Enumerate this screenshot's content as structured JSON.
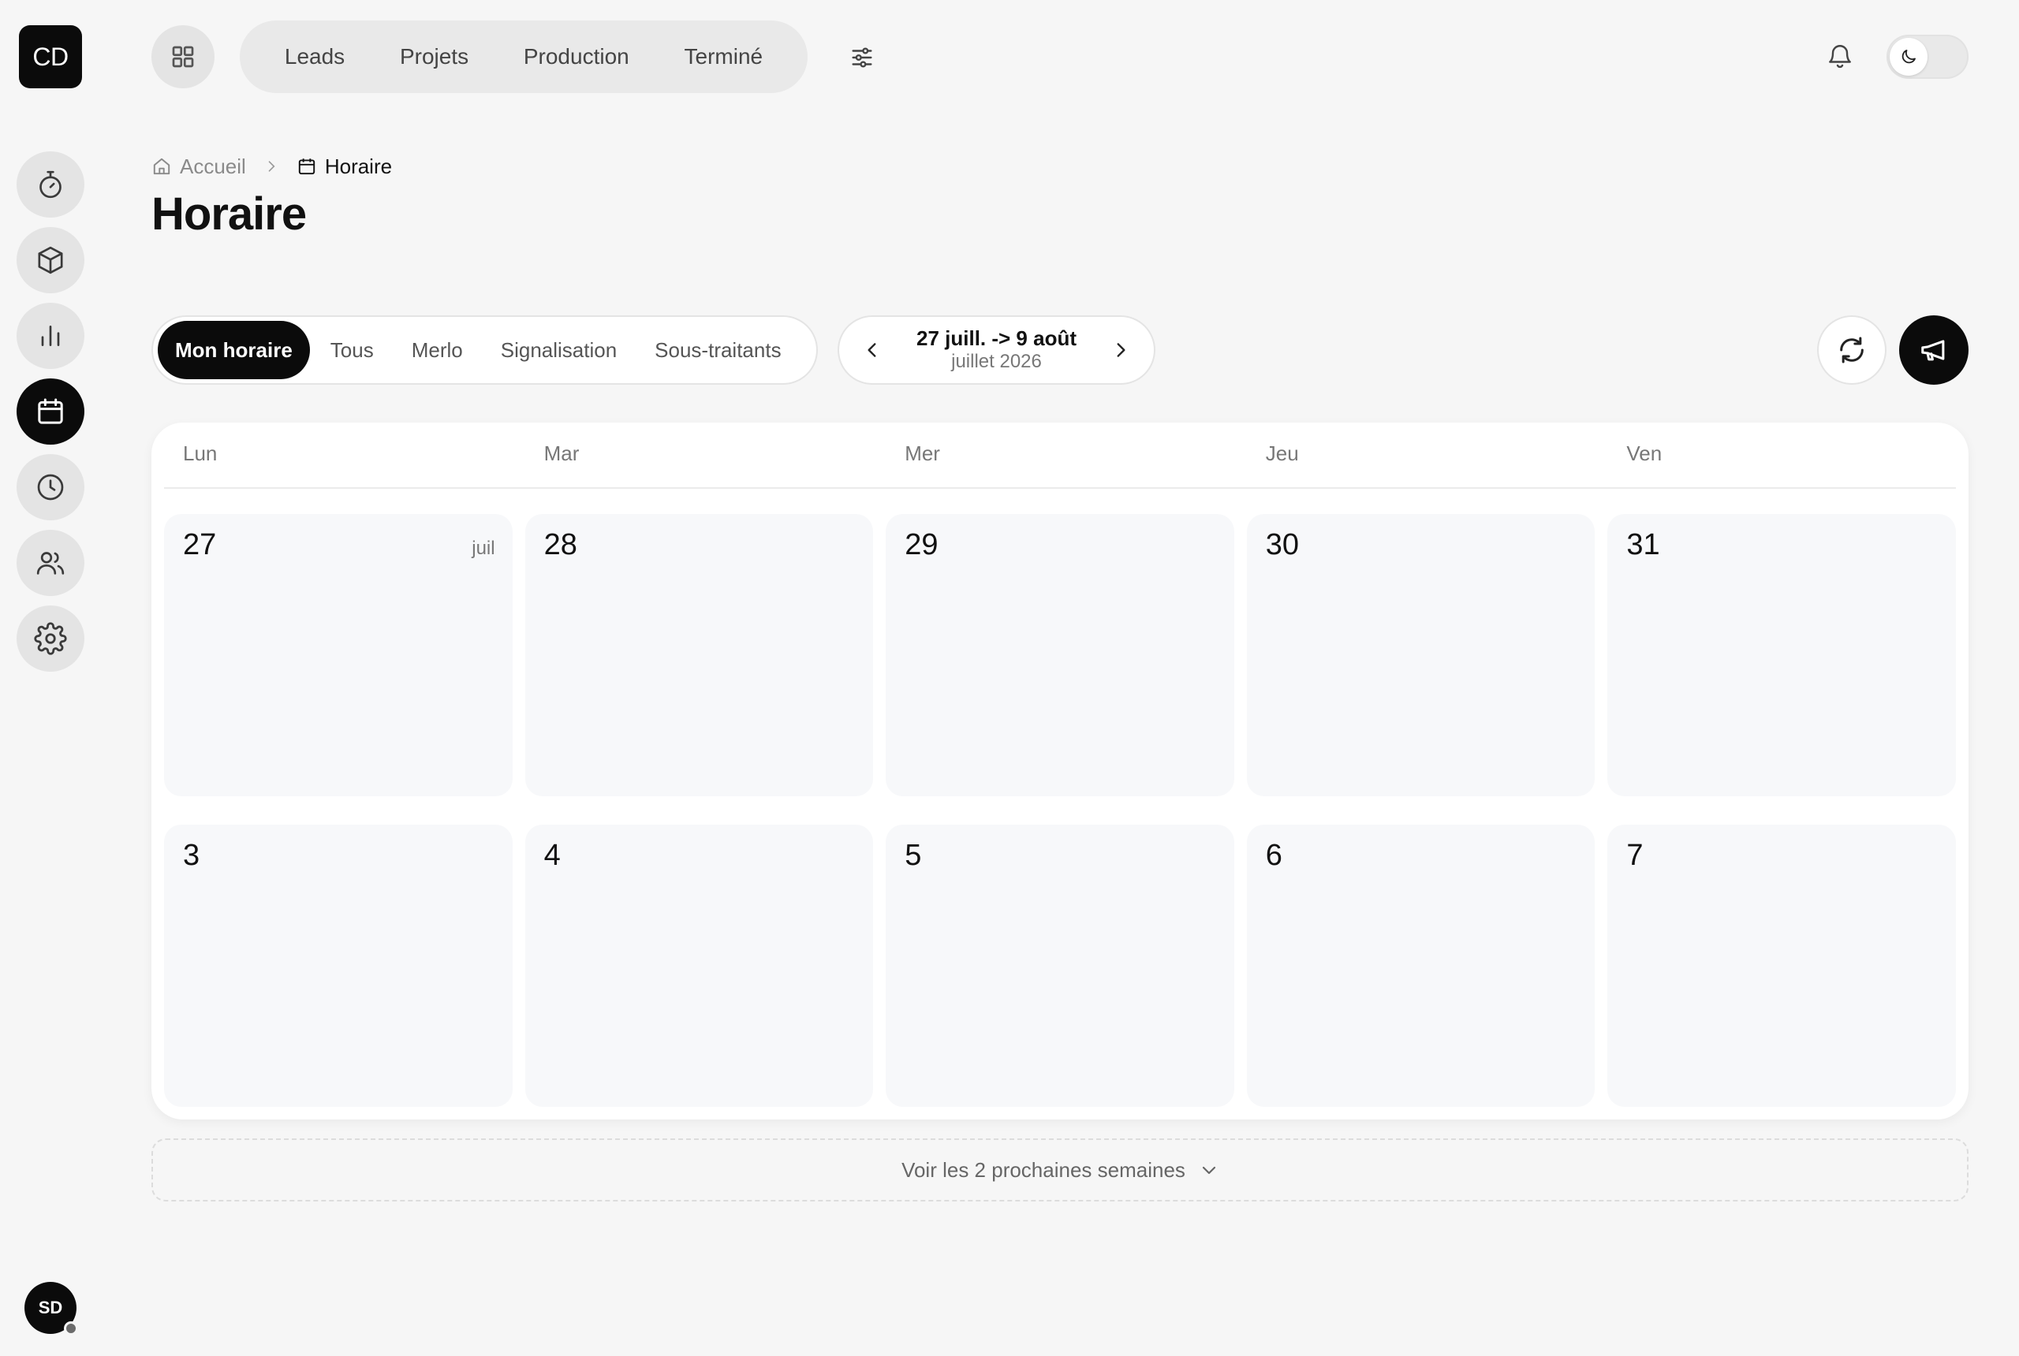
{
  "app": {
    "logo_text": "CD",
    "user_initials": "SD"
  },
  "sidebar": {
    "items": [
      {
        "name": "timer-icon",
        "active": false
      },
      {
        "name": "box-icon",
        "active": false
      },
      {
        "name": "bar-chart-icon",
        "active": false
      },
      {
        "name": "calendar-icon",
        "active": true
      },
      {
        "name": "clock-icon",
        "active": false
      },
      {
        "name": "users-icon",
        "active": false
      },
      {
        "name": "settings-icon",
        "active": false
      }
    ]
  },
  "topnav": {
    "items": [
      {
        "label": "Leads"
      },
      {
        "label": "Projets"
      },
      {
        "label": "Production"
      },
      {
        "label": "Terminé"
      }
    ]
  },
  "breadcrumb": {
    "home": "Accueil",
    "current": "Horaire"
  },
  "page": {
    "title": "Horaire"
  },
  "tabs": [
    {
      "label": "Mon horaire",
      "active": true
    },
    {
      "label": "Tous",
      "active": false
    },
    {
      "label": "Merlo",
      "active": false
    },
    {
      "label": "Signalisation",
      "active": false
    },
    {
      "label": "Sous-traitants",
      "active": false
    }
  ],
  "date_range": {
    "main": "27 juill. -> 9 août",
    "sub": "juillet 2026"
  },
  "calendar": {
    "day_names": [
      "Lun",
      "Mar",
      "Mer",
      "Jeu",
      "Ven"
    ],
    "weeks": [
      [
        {
          "day": "27",
          "month": "juil"
        },
        {
          "day": "28",
          "month": ""
        },
        {
          "day": "29",
          "month": ""
        },
        {
          "day": "30",
          "month": ""
        },
        {
          "day": "31",
          "month": ""
        }
      ],
      [
        {
          "day": "3",
          "month": ""
        },
        {
          "day": "4",
          "month": ""
        },
        {
          "day": "5",
          "month": ""
        },
        {
          "day": "6",
          "month": ""
        },
        {
          "day": "7",
          "month": ""
        }
      ]
    ]
  },
  "expand": {
    "label": "Voir les 2 prochaines semaines"
  },
  "colors": {
    "background": "#f6f6f6",
    "accent": "#0b0b0b",
    "cell": "#f7f8fa"
  }
}
